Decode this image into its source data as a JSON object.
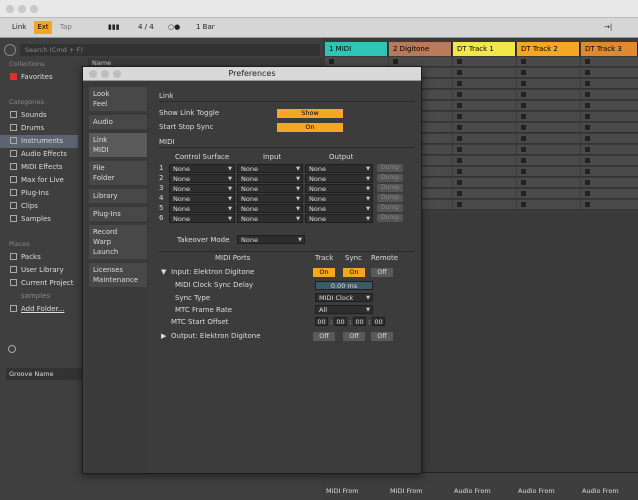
{
  "control_bar": {
    "link": "Link",
    "ext": "Ext",
    "tap": "Tap",
    "signature": "4  /  4",
    "quant": "1 Bar"
  },
  "browser": {
    "search_placeholder": "Search (Cmd + F)",
    "collections_head": "Collections",
    "favorites": "Favorites",
    "categories_head": "Categories",
    "categories": [
      "Sounds",
      "Drums",
      "Instruments",
      "Audio Effects",
      "MIDI Effects",
      "Max for Live",
      "Plug-Ins",
      "Clips",
      "Samples"
    ],
    "places_head": "Places",
    "places": [
      "Packs",
      "User Library",
      "Current Project",
      "samples",
      "Add Folder..."
    ],
    "name_col": "Name",
    "groove": "Groove Name"
  },
  "tracks": [
    {
      "name": "1 MIDI",
      "color": "#2ec4b6"
    },
    {
      "name": "2 Digitone",
      "color": "#b97a57"
    },
    {
      "name": "DT Track 1",
      "color": "#f3e64a"
    },
    {
      "name": "DT Track 2",
      "color": "#f5a623"
    },
    {
      "name": "DT Track 3",
      "color": "#e08a30"
    }
  ],
  "bottom": {
    "midi_from": "MIDI From",
    "audio_from": "Audio From"
  },
  "dialog": {
    "title": "Preferences",
    "tabs": [
      [
        "Look",
        "Feel"
      ],
      [
        "Audio"
      ],
      [
        "Link",
        "MIDI"
      ],
      [
        "File",
        "Folder"
      ],
      [
        "Library"
      ],
      [
        "Plug-Ins"
      ],
      [
        "Record",
        "Warp",
        "Launch"
      ],
      [
        "Licenses",
        "Maintenance"
      ]
    ],
    "link_head": "Link",
    "show_link_toggle": "Show Link Toggle",
    "show_link_value": "Show",
    "start_stop_sync": "Start Stop Sync",
    "start_stop_value": "On",
    "midi_head": "MIDI",
    "cs_head": "Control Surface",
    "input_head": "Input",
    "output_head": "Output",
    "cs_rows": [
      {
        "num": "1",
        "cs": "None",
        "in": "None",
        "out": "None",
        "dump": "Dump"
      },
      {
        "num": "2",
        "cs": "None",
        "in": "None",
        "out": "None",
        "dump": "Dump"
      },
      {
        "num": "3",
        "cs": "None",
        "in": "None",
        "out": "None",
        "dump": "Dump"
      },
      {
        "num": "4",
        "cs": "None",
        "in": "None",
        "out": "None",
        "dump": "Dump"
      },
      {
        "num": "5",
        "cs": "None",
        "in": "None",
        "out": "None",
        "dump": "Dump"
      },
      {
        "num": "6",
        "cs": "None",
        "in": "None",
        "out": "None",
        "dump": "Dump"
      }
    ],
    "takeover_label": "Takeover Mode",
    "takeover_value": "None",
    "ports_head": "MIDI Ports",
    "track_head": "Track",
    "sync_head": "Sync",
    "remote_head": "Remote",
    "input_port": "Input:  Elektron Digitone",
    "input_track": "On",
    "input_sync": "On",
    "input_remote": "Off",
    "clock_delay_label": "MIDI Clock Sync Delay",
    "clock_delay_value": "0.00 ms",
    "sync_type_label": "Sync Type",
    "sync_type_value": "MIDI Clock",
    "mtc_rate_label": "MTC Frame Rate",
    "mtc_rate_value": "All",
    "mtc_offset_label": "MTC Start Offset",
    "mtc_offset": [
      "00",
      "00",
      "00",
      "00"
    ],
    "output_port": "Output:  Elektron Digitone",
    "output_track": "Off",
    "output_sync": "Off",
    "output_remote": "Off"
  }
}
